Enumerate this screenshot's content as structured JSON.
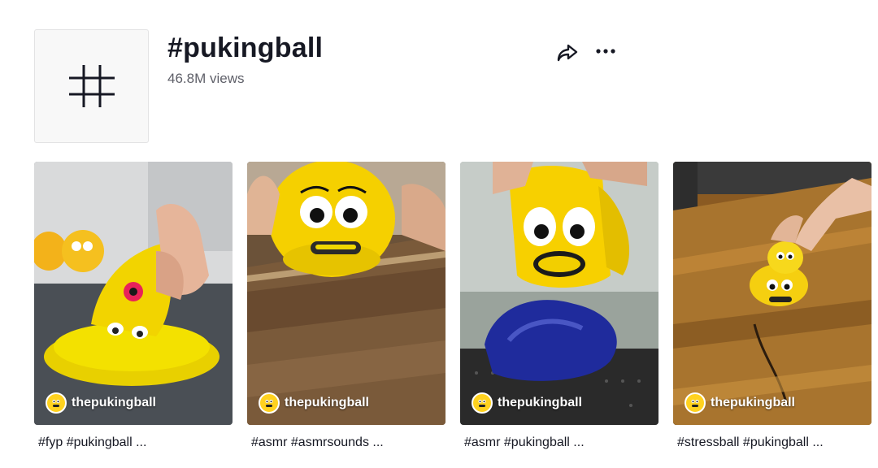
{
  "header": {
    "title": "#pukingball",
    "views": "46.8M views",
    "hash_symbol": "#"
  },
  "icons": {
    "share": "share-arrow-icon",
    "more": "ellipsis-icon",
    "hash": "hashtag-icon"
  },
  "videos": [
    {
      "author": "thepukingball",
      "caption": "#fyp #pukingball ..."
    },
    {
      "author": "thepukingball",
      "caption": "#asmr #asmrsounds ..."
    },
    {
      "author": "thepukingball",
      "caption": "#asmr #pukingball ..."
    },
    {
      "author": "thepukingball",
      "caption": "#stressball #pukingball ..."
    }
  ],
  "colors": {
    "text": "#161823",
    "muted": "#5f6069",
    "ball_yellow": "#ffd21f",
    "slime_blue": "#2a36a8"
  }
}
